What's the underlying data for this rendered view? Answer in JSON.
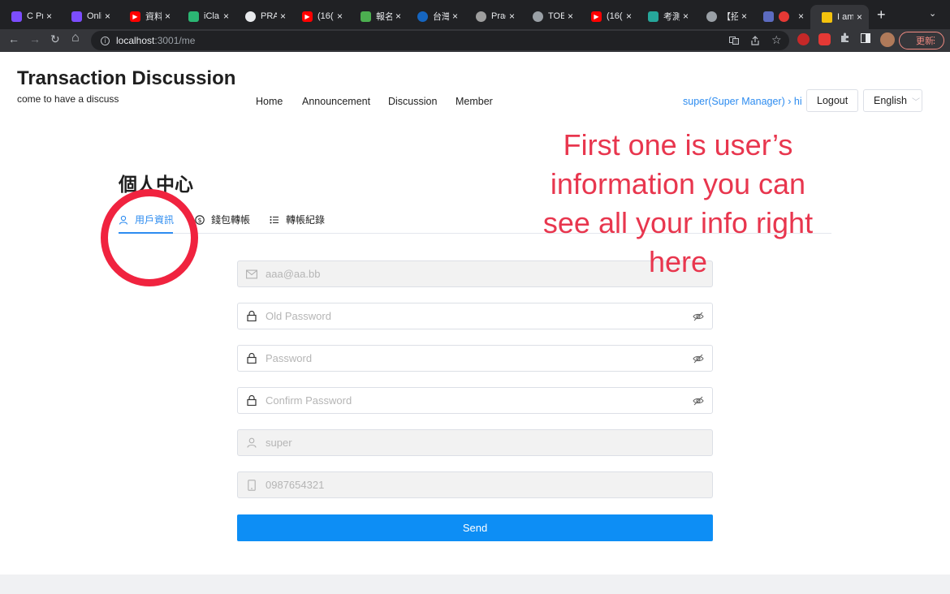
{
  "browser": {
    "tabs": [
      {
        "title": "C Pr",
        "favicon_color": "#7c4dff",
        "active": false
      },
      {
        "title": "Onli",
        "favicon_color": "#7c4dff",
        "active": false
      },
      {
        "title": "資料",
        "favicon_color": "#ff0000",
        "active": false
      },
      {
        "title": "iCla",
        "favicon_color": "#2bb673",
        "active": false
      },
      {
        "title": "PRA",
        "favicon_color": "#e8eaed",
        "active": false
      },
      {
        "title": "(16(",
        "favicon_color": "#ff0000",
        "active": false
      },
      {
        "title": "報名",
        "favicon_color": "#4caf50",
        "active": false
      },
      {
        "title": "台灣",
        "favicon_color": "#1565c0",
        "active": false
      },
      {
        "title": "Prac",
        "favicon_color": "#9e9e9e",
        "active": false
      },
      {
        "title": "TOE",
        "favicon_color": "#9aa0a6",
        "active": false
      },
      {
        "title": "(16(",
        "favicon_color": "#ff0000",
        "active": false
      },
      {
        "title": "考測",
        "favicon_color": "#26a69a",
        "active": false
      },
      {
        "title": "【招",
        "favicon_color": "#9aa0a6",
        "active": false
      },
      {
        "title": "",
        "favicon_color": "#5c6bc0",
        "active": false
      },
      {
        "title": "I am",
        "favicon_color": "#f4c20d",
        "active": true
      }
    ],
    "tab_close_glyph": "×",
    "new_tab_glyph": "+",
    "tab_menu_glyph": "⌄",
    "back_glyph": "←",
    "forward_glyph": "→",
    "reload_glyph": "↻",
    "home_glyph": "⌂",
    "url_host": "localhost",
    "url_path": ":3001/me",
    "update_label": "更新"
  },
  "site": {
    "title": "Transaction Discussion",
    "subtitle": "come to have a discuss",
    "nav": [
      "Home",
      "Announcement",
      "Discussion",
      "Member"
    ],
    "user_link": "super(Super Manager) › hi",
    "logout_label": "Logout",
    "language_label": "English"
  },
  "profile": {
    "heading": "個人中心",
    "tabs": [
      {
        "label": "用戶資訊",
        "icon": "user-icon",
        "active": true
      },
      {
        "label": "錢包轉帳",
        "icon": "dollar-icon",
        "active": false
      },
      {
        "label": "轉帳紀錄",
        "icon": "list-icon",
        "active": false
      }
    ],
    "fields": {
      "email": {
        "placeholder": "aaa@aa.bb",
        "icon": "mail-icon",
        "disabled": true
      },
      "old_password": {
        "placeholder": "Old Password",
        "icon": "lock-icon"
      },
      "password": {
        "placeholder": "Password",
        "icon": "lock-icon"
      },
      "confirm_password": {
        "placeholder": "Confirm Password",
        "icon": "lock-icon"
      },
      "username": {
        "placeholder": "super",
        "icon": "user-icon",
        "disabled": true
      },
      "phone": {
        "placeholder": "0987654321",
        "icon": "phone-icon",
        "disabled": true
      }
    },
    "send_label": "Send"
  },
  "annotation": {
    "text": "First one is user’s information you can see all your info right here",
    "color": "#e8364e",
    "circle_color": "#f0233f"
  },
  "colors": {
    "accent": "#2d8cf0",
    "send_button": "#0d8ef5"
  }
}
